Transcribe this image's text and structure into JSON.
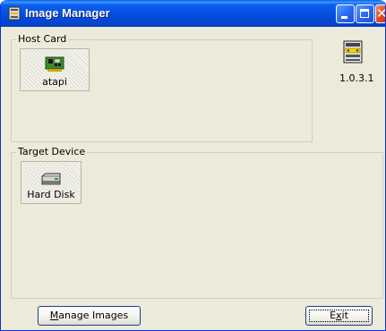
{
  "window": {
    "title": "Image Manager",
    "controls": {
      "minimize": "minimize",
      "maximize": "maximize",
      "close": "close"
    }
  },
  "host_card": {
    "group_label": "Host Card",
    "items": [
      {
        "label": "atapi",
        "icon": "expansion-card-icon",
        "selected": true
      }
    ]
  },
  "version": {
    "icon": "server-icon",
    "text": "1.0.3.1"
  },
  "target_device": {
    "group_label": "Target Device",
    "items": [
      {
        "label": "Hard Disk",
        "icon": "hard-disk-icon",
        "selected": true
      }
    ]
  },
  "buttons": {
    "manage_images": {
      "label_prefix": "",
      "label_mnemonic": "M",
      "label_rest": "anage Images"
    },
    "exit": {
      "label_prefix": "E",
      "label_mnemonic": "x",
      "label_rest": "it"
    }
  },
  "colors": {
    "titlebar": "#0550e0",
    "window_bg": "#ecead8",
    "close_button": "#e0502c"
  }
}
